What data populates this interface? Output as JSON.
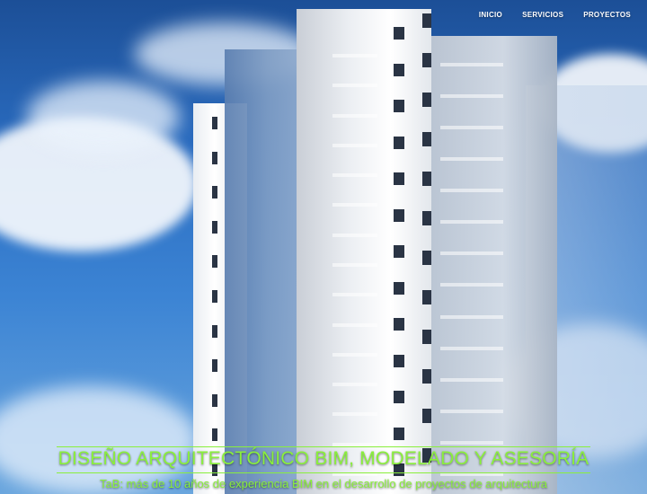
{
  "nav": {
    "items": [
      "INICIO",
      "SERVICIOS",
      "PROYECTOS"
    ]
  },
  "hero": {
    "headline": "DISEÑO ARQUITECTÓNICO BIM, MODELADO Y ASESORÍA",
    "subline": "TaB: más de 10 años de experiencia BIM en el desarrollo de proyectos de arquitectura",
    "accent_color": "#8aef3c",
    "sky_color": "#2a6cc0"
  }
}
